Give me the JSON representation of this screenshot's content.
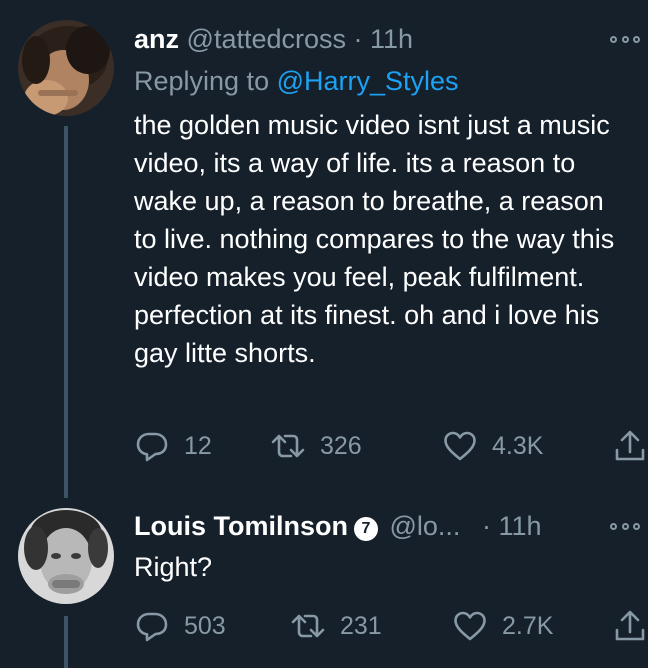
{
  "tweets": [
    {
      "author_name": "anz",
      "handle": "@tattedcross",
      "separator": "·",
      "time": "11h",
      "replying_prefix": "Replying to",
      "replying_to": "@Harry_Styles",
      "text": "the golden music video isnt just a music video, its a way of life. its a reason to wake up, a reason to breathe, a reason to live. nothing compares to the way this video makes you feel, peak fulfilment. perfection at its finest. oh and i love his gay litte shorts.",
      "replies": "12",
      "retweets": "326",
      "likes": "4.3K"
    },
    {
      "author_name": "Louis Tomilnson",
      "verified_badge": "7",
      "handle": "@lo...",
      "separator": "·",
      "time": "11h",
      "text": "Right?",
      "replies": "503",
      "retweets": "231",
      "likes": "2.7K"
    }
  ],
  "icons": {
    "reply": "reply-icon",
    "retweet": "retweet-icon",
    "like": "heart-icon",
    "share": "share-icon",
    "more": "more-options-icon"
  },
  "colors": {
    "background": "#15202b",
    "text": "#ffffff",
    "secondary": "#8899a6",
    "link": "#1da1f2",
    "thread_line": "#3d5466"
  }
}
